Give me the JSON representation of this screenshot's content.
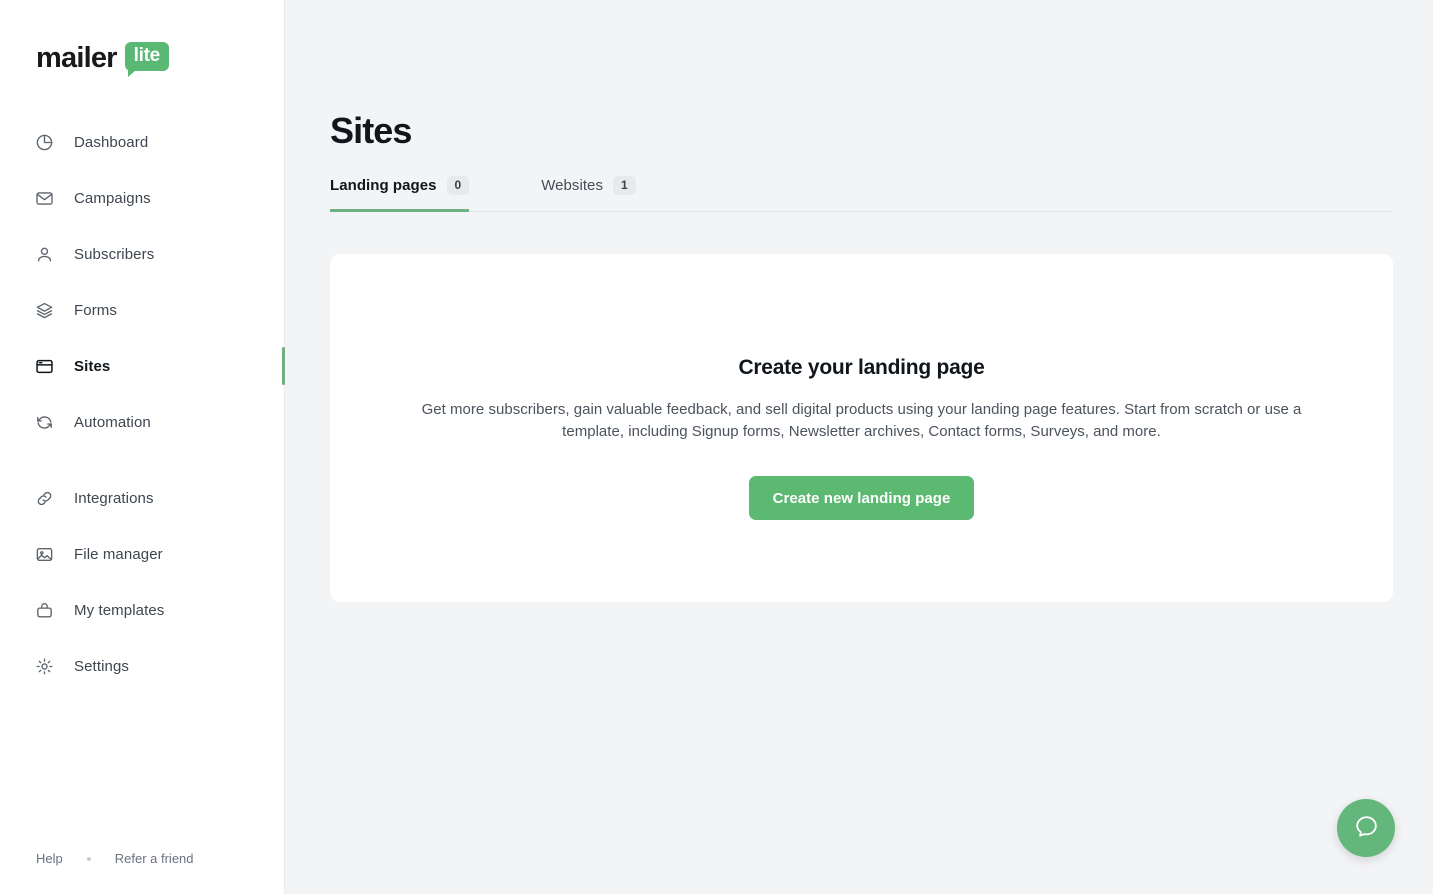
{
  "brand": {
    "word": "mailer",
    "badge": "lite"
  },
  "sidebar": {
    "groups": [
      {
        "items": [
          {
            "label": "Dashboard",
            "icon": "pie-chart-icon",
            "active": false
          },
          {
            "label": "Campaigns",
            "icon": "envelope-icon",
            "active": false
          },
          {
            "label": "Subscribers",
            "icon": "person-icon",
            "active": false
          },
          {
            "label": "Forms",
            "icon": "layers-icon",
            "active": false
          },
          {
            "label": "Sites",
            "icon": "browser-icon",
            "active": true
          },
          {
            "label": "Automation",
            "icon": "refresh-icon",
            "active": false
          }
        ]
      },
      {
        "items": [
          {
            "label": "Integrations",
            "icon": "link-icon",
            "active": false
          },
          {
            "label": "File manager",
            "icon": "image-icon",
            "active": false
          },
          {
            "label": "My templates",
            "icon": "briefcase-icon",
            "active": false
          },
          {
            "label": "Settings",
            "icon": "gear-icon",
            "active": false
          }
        ]
      }
    ],
    "footer": {
      "help": "Help",
      "refer": "Refer a friend"
    }
  },
  "main": {
    "title": "Sites",
    "tabs": [
      {
        "label": "Landing pages",
        "badge": "0",
        "active": true
      },
      {
        "label": "Websites",
        "badge": "1",
        "active": false
      }
    ],
    "empty_state": {
      "heading": "Create your landing page",
      "description": "Get more subscribers, gain valuable feedback, and sell digital products using your landing page features. Start from scratch or use a template, including Signup forms, Newsletter archives, Contact forms, Surveys, and more.",
      "cta_label": "Create new landing page"
    }
  },
  "help_widget": {
    "icon": "chat-bubble-icon"
  },
  "colors": {
    "brand_green": "#59b974",
    "cta_green": "#5cb972",
    "active_indicator": "#6fb183",
    "page_background": "#f3f4f6",
    "card_background": "#ffffff",
    "badge_background": "#e7e9ec"
  }
}
